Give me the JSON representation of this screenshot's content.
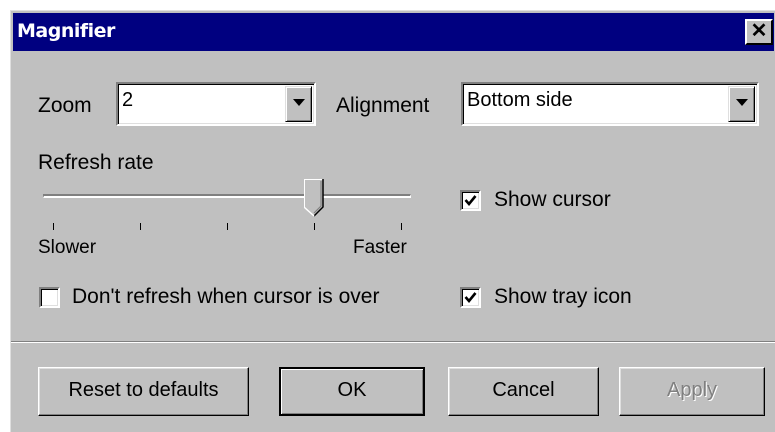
{
  "window": {
    "title": "Magnifier",
    "close_glyph": "✕"
  },
  "zoom": {
    "label": "Zoom",
    "value": "2"
  },
  "alignment": {
    "label": "Alignment",
    "value": "Bottom side"
  },
  "refresh": {
    "label": "Refresh rate",
    "min_label": "Slower",
    "max_label": "Faster",
    "tick_count": 5,
    "position_fraction": 0.75
  },
  "options": {
    "show_cursor": {
      "label": "Show cursor",
      "checked": true
    },
    "show_tray_icon": {
      "label": "Show tray icon",
      "checked": true
    },
    "dont_refresh": {
      "label": "Don't refresh when cursor is over",
      "checked": false
    }
  },
  "buttons": {
    "reset": "Reset to defaults",
    "ok": "OK",
    "cancel": "Cancel",
    "apply": "Apply"
  },
  "icons": {
    "close": "close-icon",
    "dropdown": "chevron-down-icon",
    "check": "checkmark-icon"
  },
  "colors": {
    "titlebar": "#000080",
    "face": "#c0c0c0",
    "disabled_text": "#808080"
  }
}
